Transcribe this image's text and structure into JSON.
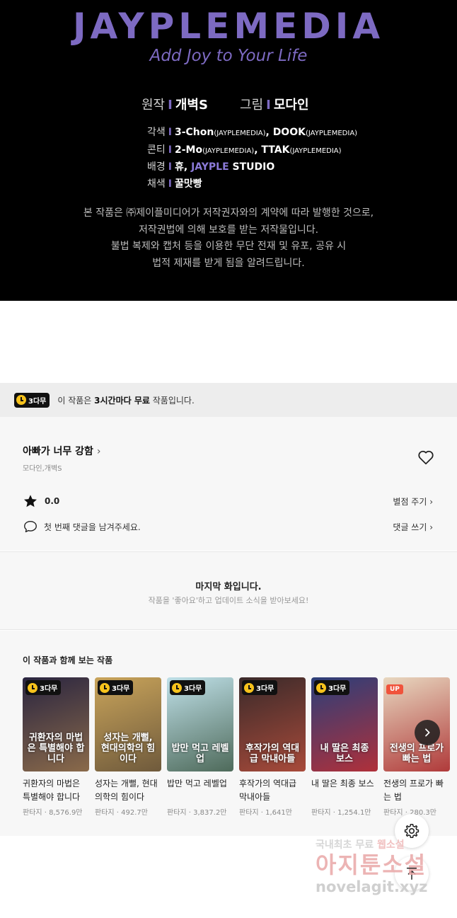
{
  "banner": {
    "logo": "JAYPLEMEDIA",
    "tagline": "Add Joy to Your Life",
    "original_label": "원작",
    "original_value": "개벽S",
    "art_label": "그림",
    "art_value": "모다인",
    "divider": "I",
    "rows": [
      {
        "label": "각색",
        "v1": "3-Chon",
        "s1": "(JAYPLEMEDIA)",
        "sep": ", ",
        "v2": "DOOK",
        "s2": "(JAYPLEMEDIA)"
      },
      {
        "label": "콘티",
        "v1": "2-Mo",
        "s1": "(JAYPLEMEDIA)",
        "sep": ", ",
        "v2": "TTAK",
        "s2": "(JAYPLEMEDIA)"
      }
    ],
    "bg_label": "배경",
    "bg_value1": "휴, ",
    "bg_value_purple": "JAYPLE",
    "bg_value2": " STUDIO",
    "color_label": "채색",
    "color_value": "꿀맛빵",
    "notice_lines": [
      "본 작품은 ㈜제이플미디어가 저작권자와의 계약에 따라 발행한 것으로,",
      "저작권법에 의해 보호를 받는 저작물입니다.",
      "불법 복제와 캡처 등을 이용한 무단 전재 및 유포, 공유 시",
      "법적 제재를 받게 됨을 알려드립니다."
    ]
  },
  "free_bar": {
    "badge": "3다무",
    "text_pre": "이 작품은 ",
    "text_bold": "3시간마다 무료",
    "text_post": " 작품입니다."
  },
  "info": {
    "title": "아빠가 너무 강함",
    "chevron": "›",
    "authors": "모다인,개벽S",
    "rating": "0.0",
    "rate_link": "별점 주기 ›",
    "comment_text": "첫 번째 댓글을 남겨주세요.",
    "comment_link": "댓글 쓰기 ›"
  },
  "last": {
    "heading": "마지막 화입니다.",
    "sub": "작품을 '좋아요'하고 업데이트 소식을 받아보세요!"
  },
  "recs": {
    "title": "이 작품과 함께 보는 작품",
    "items": [
      {
        "tag": "3다무",
        "tag_type": "free",
        "cover_text": "귀환자의 마법은 특별해야 합니다",
        "name": "귀환자의 마법은 특별해야 합니다",
        "meta": "판타지 · 8,576.9만",
        "c1": "#2a2540",
        "c2": "#8a6a4a"
      },
      {
        "tag": "3다무",
        "tag_type": "free",
        "cover_text": "성자는 개뻘, 현대의학의 힘이다",
        "name": "성자는 개뻘, 현대의학의 힘이다",
        "meta": "판타지 · 492.7만",
        "c1": "#c9a45a",
        "c2": "#6f5a3c"
      },
      {
        "tag": "3다무",
        "tag_type": "free",
        "cover_text": "밥만 먹고 레벨업",
        "name": "밥만 먹고 레벨업",
        "meta": "판타지 · 3,837.2만",
        "c1": "#bfe0e8",
        "c2": "#4e6a5a"
      },
      {
        "tag": "3다무",
        "tag_type": "free",
        "cover_text": "후작가의 역대급 막내아들",
        "name": "후작가의 역대급 막내아들",
        "meta": "판타지 · 1,641만",
        "c1": "#3a2a2a",
        "c2": "#a84a3a"
      },
      {
        "tag": "3다무",
        "tag_type": "free",
        "cover_text": "내 딸은 최종 보스",
        "name": "내 딸은 최종 보스",
        "meta": "판타지 · 1,254.1만",
        "c1": "#2b3f7a",
        "c2": "#b0303a"
      },
      {
        "tag": "UP",
        "tag_type": "up",
        "cover_text": "전생의 프로가 빠는 법",
        "name": "전생의 프로가 빠는 법",
        "meta": "판타지 · 280.3만",
        "c1": "#e8d8c0",
        "c2": "#b03a3a"
      }
    ]
  },
  "watermark": {
    "line1_a": "국내최초 무료",
    "line1_b": "웹소설",
    "line2": "아지툰소설",
    "line3": "novelagit.xyz"
  },
  "icons": {
    "heart": "heart-icon",
    "star": "star-icon",
    "comment": "comment-icon",
    "next": "chevron-right-icon",
    "settings": "gear-icon",
    "top": "arrow-up-icon",
    "clock": "clock-icon"
  },
  "colors": {
    "brand_purple": "#7d6ac2",
    "free_yellow": "#f6c21c",
    "up_red": "#f0533c"
  }
}
